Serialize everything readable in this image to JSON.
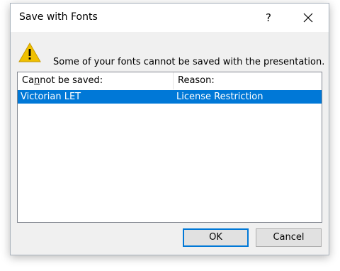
{
  "window": {
    "title": "Save with Fonts",
    "help_label": "?"
  },
  "message": {
    "text": "Some of your fonts cannot be saved with the presentation."
  },
  "list": {
    "columns": [
      {
        "label_pre": "Ca",
        "label_mnemonic": "n",
        "label_post": "not be saved:"
      },
      {
        "label": "Reason:"
      }
    ],
    "rows": [
      {
        "font": "Victorian LET",
        "reason": "License Restriction",
        "selected": true
      }
    ]
  },
  "buttons": {
    "ok_label": "OK",
    "cancel_label": "Cancel"
  },
  "colors": {
    "selection": "#0078d7",
    "default_button_border": "#0078d7",
    "dialog_bg": "#f0f0f0",
    "warning_yellow": "#f0c000"
  },
  "icons": {
    "warning": "warning-icon",
    "close": "close-icon",
    "help": "help-icon"
  }
}
